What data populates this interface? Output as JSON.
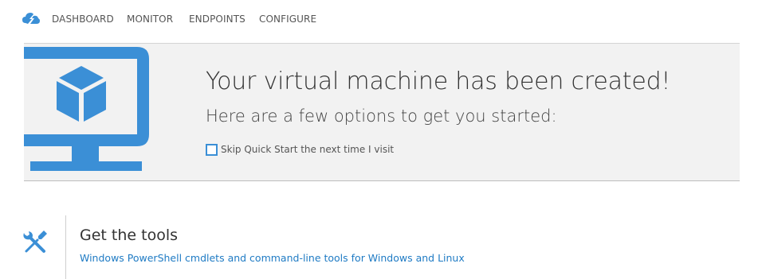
{
  "nav": {
    "items": [
      {
        "label": "DASHBOARD"
      },
      {
        "label": "MONITOR"
      },
      {
        "label": "ENDPOINTS"
      },
      {
        "label": "CONFIGURE"
      }
    ]
  },
  "hero": {
    "title": "Your virtual machine has been created!",
    "subtitle": "Here are a few options to get you started:",
    "skip_label": "Skip Quick Start the next time I visit",
    "skip_checked": false
  },
  "tools": {
    "heading": "Get the tools",
    "link": "Windows PowerShell cmdlets and command-line tools for Windows and Linux"
  },
  "colors": {
    "accent": "#3b8fd6",
    "link": "#1f7bc4",
    "banner_bg": "#f2f2f2"
  },
  "icons": {
    "quickstart": "cloud-lightning-icon",
    "monitor": "monitor-cube-icon",
    "tools": "wrench-screwdriver-icon"
  }
}
